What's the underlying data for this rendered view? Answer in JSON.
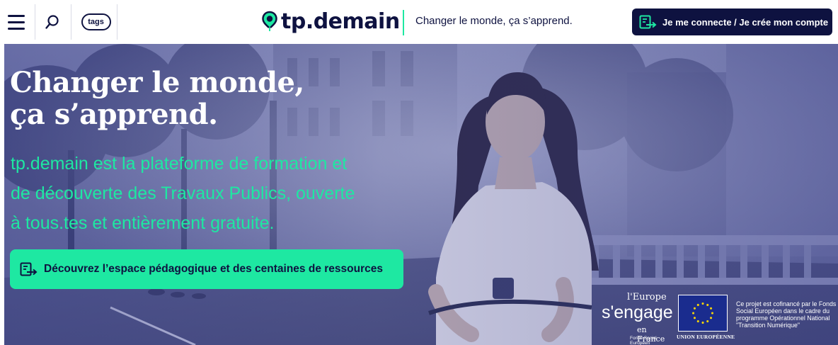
{
  "header": {
    "tags_label": "tags",
    "logo_text": "tp.demain",
    "tagline": "Changer le monde, ça s’apprend.",
    "login_label": "Je me connecte / Je crée mon compte"
  },
  "hero": {
    "title_line1": "Changer le monde,",
    "title_line2": "ça s’apprend.",
    "desc_line1": "tp.demain est la plateforme de formation et",
    "desc_line2": "de découverte des Travaux Publics, ouverte",
    "desc_line3": "à tous.tes et entièrement gratuite.",
    "cta_label": "Découvrez l’espace pédagogique et des centaines de ressources"
  },
  "eu": {
    "engage_line1": "l'Europe",
    "engage_line2": "s'engage",
    "engage_line3": "en France",
    "engage_line4": "Fonds Social Européen",
    "union_label": "UNION EUROPÉENNE",
    "cofinance_text": "Ce projet est cofinancé par le Fonds Social Européen dans le cadre du programme Opérationnel National \"Transition Numérique\""
  },
  "colors": {
    "navy": "#0e1240",
    "mint": "#1ee8a2",
    "white": "#ffffff"
  },
  "icons": [
    "menu-icon",
    "search-icon",
    "login-icon",
    "location-pin-icon",
    "eu-flag-icon"
  ]
}
